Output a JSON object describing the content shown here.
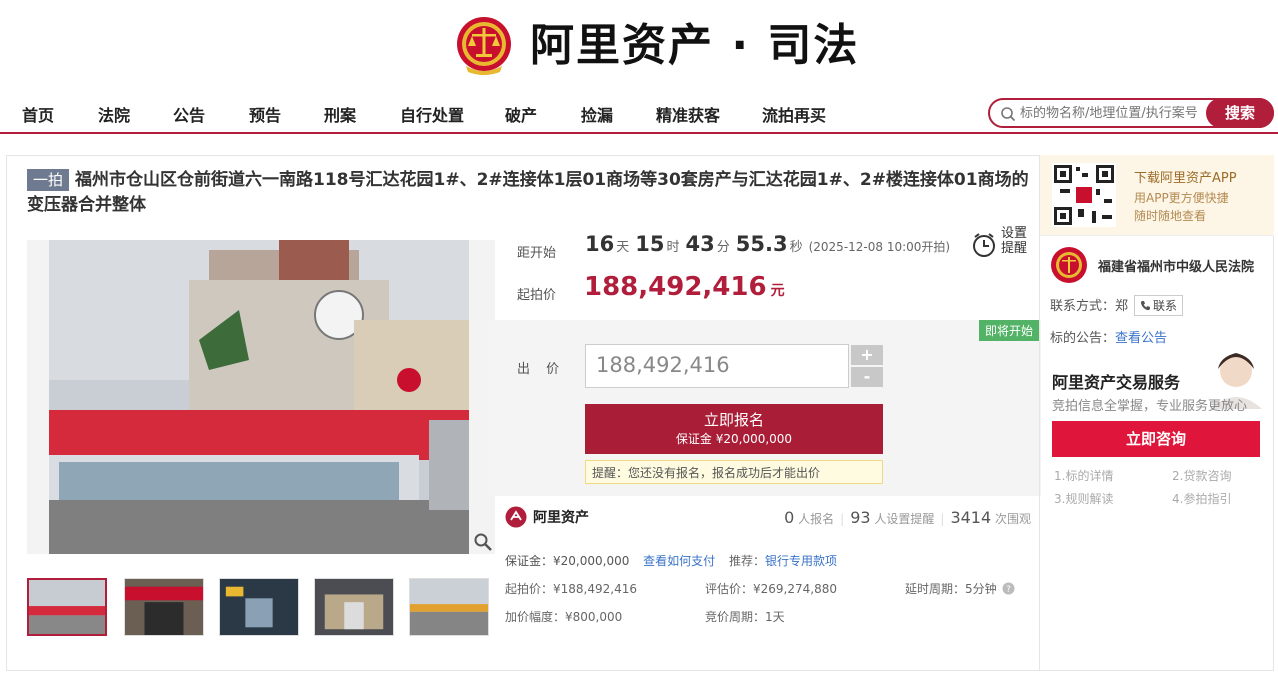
{
  "brand": {
    "name": "阿里资产 · 司法"
  },
  "nav": {
    "items": [
      "首页",
      "法院",
      "公告",
      "预告",
      "刑案",
      "自行处置",
      "破产",
      "捡漏",
      "精准获客",
      "流拍再买"
    ]
  },
  "search": {
    "placeholder": "标的物名称/地理位置/执行案号",
    "button": "搜索"
  },
  "item": {
    "tag": "一拍",
    "title": "福州市仓山区仓前街道六一南路118号汇达花园1#、2#连接体1层01商场等30套房产与汇达花园1#、2#楼连接体01商场的变压器合并整体"
  },
  "countdown": {
    "label": "距开始",
    "days": "16",
    "days_unit": "天",
    "hours": "15",
    "hours_unit": "时",
    "minutes": "43",
    "minutes_unit": "分",
    "seconds": "55.3",
    "seconds_unit": "秒",
    "start_time": "(2025-12-08 10:00开拍)"
  },
  "remind": {
    "line1": "设置",
    "line2": "提醒"
  },
  "start_price": {
    "label": "起拍价",
    "value": "188,492,416",
    "unit": "元"
  },
  "bid": {
    "badge": "即将开始",
    "label": "出 价",
    "value": "188,492,416",
    "plus": "+",
    "minus": "-",
    "signup": "立即报名",
    "deposit": "保证金 ¥20,000,000",
    "tip": "提醒：您还没有报名，报名成功后才能出价"
  },
  "stats": {
    "brand": "阿里资产",
    "signups": "0",
    "signups_label": "人报名",
    "reminders": "93",
    "reminders_label": "人设置提醒",
    "views": "3414",
    "views_label": "次围观"
  },
  "details": {
    "deposit": "保证金：¥20,000,000",
    "how_to_pay": "查看如何支付",
    "recommend_label": "推荐：",
    "recommend_link": "银行专用款项",
    "start_price": "起拍价：¥188,492,416",
    "appraisal": "评估价：¥269,274,880",
    "delay": "延时周期：5分钟",
    "increment": "加价幅度：¥800,000",
    "cycle": "竞价周期：1天"
  },
  "side": {
    "app_title": "下载阿里资产APP",
    "app_sub1": "用APP更方便快捷",
    "app_sub2": "随时随地查看",
    "court": "福建省福州市中级人民法院",
    "contact_label": "联系方式：郑",
    "contact_btn": "联系",
    "notice_label": "标的公告：",
    "notice_link": "查看公告",
    "service_title": "阿里资产交易服务",
    "service_sub": "竞拍信息全掌握，专业服务更放心",
    "consult": "立即咨询",
    "svc1": "1.标的详情",
    "svc2": "2.贷款咨询",
    "svc3": "3.规则解读",
    "svc4": "4.参拍指引"
  },
  "colors": {
    "accent": "#b01e3c",
    "price": "#b01e3c",
    "link": "#3a73c9",
    "soon": "#52b265"
  },
  "icons": [
    "court-emblem-icon",
    "search-icon",
    "alarm-clock-icon",
    "zoom-icon",
    "alibaba-asset-logo-icon",
    "help-icon",
    "phone-icon",
    "qr-code-icon"
  ]
}
